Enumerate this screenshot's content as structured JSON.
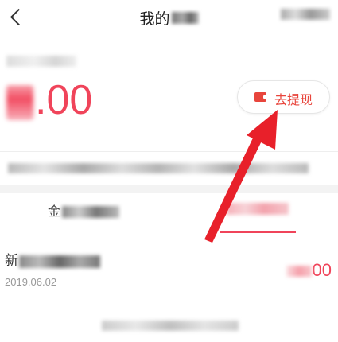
{
  "header": {
    "back_icon": "chevron-left-icon",
    "title_visible": "我的",
    "title_blurred": "钱包",
    "right_action_blurred": "明细"
  },
  "balance": {
    "label_blurred": "余额(元)",
    "amount_visible": ".00",
    "amount_blurred_digit": "1"
  },
  "withdraw_button": {
    "icon": "wallet-icon",
    "label": "去提现"
  },
  "notice_blurred": "提示信息",
  "tabs": [
    {
      "visible_char": "金",
      "blurred": "额明细",
      "active": false
    },
    {
      "blurred": "提现记录",
      "active": true
    }
  ],
  "transaction": {
    "title_visible": "新",
    "title_blurred": "人红包奖励",
    "date": "2019.06.02",
    "amount_visible": "00",
    "amount_blurred": "+1."
  },
  "footer_note_blurred": "没有更多了",
  "colors": {
    "accent_red": "#f0445a",
    "button_red": "#e8453c",
    "annotation_arrow": "#e8202a"
  }
}
